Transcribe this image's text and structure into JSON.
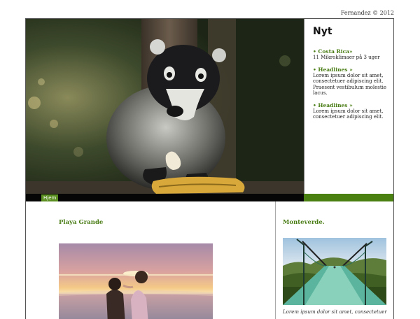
{
  "header": {
    "credit": "Fernandez © 2012"
  },
  "news": {
    "title": "Nyt",
    "items": [
      {
        "title": "• Costa Rica»",
        "body": "11 Mikroklimaer på 3 uger"
      },
      {
        "title": "• Headlines »",
        "body": "Lorem ipsum dolor sit amet, consectetuer adipiscing elit. Praesent vestibulum molestie lacus."
      },
      {
        "title": "• Headlines »",
        "body": "Lorem ipsum dolor sit amet, consectetuer adipiscing elit."
      }
    ]
  },
  "nav": {
    "tabs": [
      {
        "label": "Hjem"
      }
    ]
  },
  "main": {
    "title": "Playa Grande"
  },
  "side": {
    "title": "Monteverde.",
    "caption": "Lorem ipsum dolor sit amet, consectetuer"
  },
  "colors": {
    "accent": "#4a7d16",
    "navbar": "#060606",
    "navbar_green": "#4a8011"
  },
  "images": {
    "hero": "coati-photo",
    "beach": "beach-sunset-photo",
    "bridge": "hanging-bridge-photo"
  }
}
